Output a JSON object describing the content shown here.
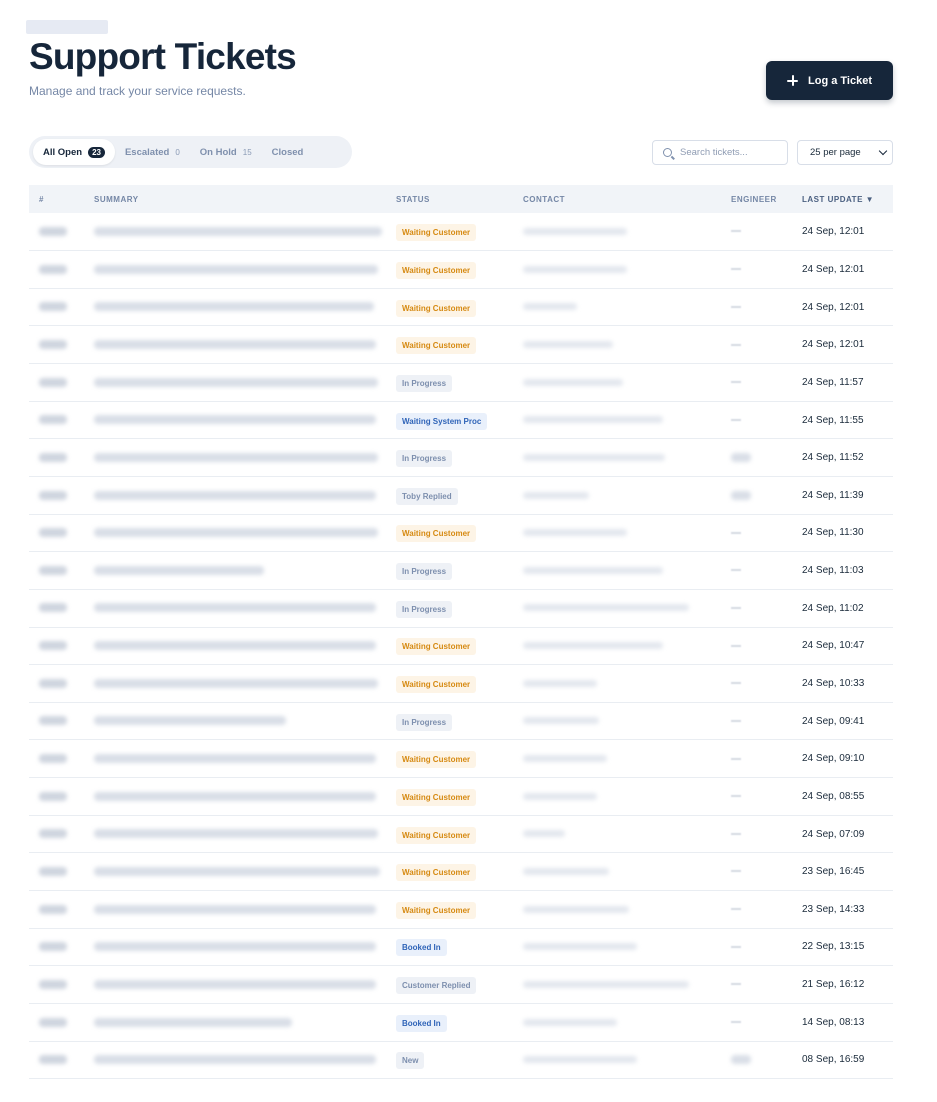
{
  "header": {
    "title": "Support Tickets",
    "subtitle": "Manage and track your service requests.",
    "log_button": "Log a Ticket"
  },
  "tabs": [
    {
      "label": "All Open",
      "count": "23"
    },
    {
      "label": "Escalated",
      "count": "0"
    },
    {
      "label": "On Hold",
      "count": "15"
    },
    {
      "label": "Closed",
      "count": ""
    }
  ],
  "search": {
    "placeholder": "Search tickets..."
  },
  "per_page": {
    "selected": "25 per page"
  },
  "table": {
    "columns": [
      "#",
      "SUMMARY",
      "STATUS",
      "CONTACT",
      "ENGINEER",
      "LAST UPDATE ▼"
    ],
    "rows": [
      {
        "status": "Waiting Customer",
        "last_update": "24 Sep, 12:01"
      },
      {
        "status": "Waiting Customer",
        "last_update": "24 Sep, 12:01"
      },
      {
        "status": "Waiting Customer",
        "last_update": "24 Sep, 12:01"
      },
      {
        "status": "Waiting Customer",
        "last_update": "24 Sep, 12:01"
      },
      {
        "status": "In Progress",
        "last_update": "24 Sep, 11:57"
      },
      {
        "status": "Waiting System Proc",
        "last_update": "24 Sep, 11:55"
      },
      {
        "status": "In Progress",
        "last_update": "24 Sep, 11:52"
      },
      {
        "status": "Toby Replied",
        "last_update": "24 Sep, 11:39"
      },
      {
        "status": "Waiting Customer",
        "last_update": "24 Sep, 11:30"
      },
      {
        "status": "In Progress",
        "last_update": "24 Sep, 11:03"
      },
      {
        "status": "In Progress",
        "last_update": "24 Sep, 11:02"
      },
      {
        "status": "Waiting Customer",
        "last_update": "24 Sep, 10:47"
      },
      {
        "status": "Waiting Customer",
        "last_update": "24 Sep, 10:33"
      },
      {
        "status": "In Progress",
        "last_update": "24 Sep, 09:41"
      },
      {
        "status": "Waiting Customer",
        "last_update": "24 Sep, 09:10"
      },
      {
        "status": "Waiting Customer",
        "last_update": "24 Sep, 08:55"
      },
      {
        "status": "Waiting Customer",
        "last_update": "24 Sep, 07:09"
      },
      {
        "status": "Waiting Customer",
        "last_update": "23 Sep, 16:45"
      },
      {
        "status": "Waiting Customer",
        "last_update": "23 Sep, 14:33"
      },
      {
        "status": "Booked In",
        "last_update": "22 Sep, 13:15"
      },
      {
        "status": "Customer Replied",
        "last_update": "21 Sep, 16:12"
      },
      {
        "status": "Booked In",
        "last_update": "14 Sep, 08:13"
      },
      {
        "status": "New",
        "last_update": "08 Sep, 16:59"
      }
    ]
  }
}
